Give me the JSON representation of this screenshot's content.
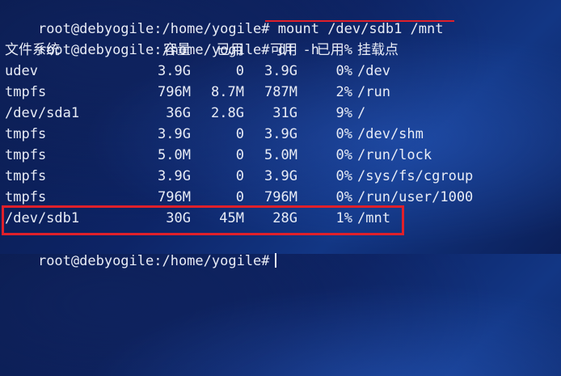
{
  "terminal": {
    "line1": {
      "prompt": "root@debyogile:/home/yogile#",
      "command": "mount /dev/sdb1 /mnt"
    },
    "line2": {
      "prompt": "root@debyogile:/home/yogile#",
      "command": "df -h"
    },
    "headers": {
      "filesystem": "文件系统",
      "size": "容量",
      "used": "已用",
      "avail": "可用",
      "use_pct": "已用%",
      "mounted_on": "挂载点"
    },
    "rows": [
      {
        "fs": "udev",
        "size": "3.9G",
        "used": "0",
        "avail": "3.9G",
        "pct": "0%",
        "mount": "/dev"
      },
      {
        "fs": "tmpfs",
        "size": "796M",
        "used": "8.7M",
        "avail": "787M",
        "pct": "2%",
        "mount": "/run"
      },
      {
        "fs": "/dev/sda1",
        "size": "36G",
        "used": "2.8G",
        "avail": "31G",
        "pct": "9%",
        "mount": "/"
      },
      {
        "fs": "tmpfs",
        "size": "3.9G",
        "used": "0",
        "avail": "3.9G",
        "pct": "0%",
        "mount": "/dev/shm"
      },
      {
        "fs": "tmpfs",
        "size": "5.0M",
        "used": "0",
        "avail": "5.0M",
        "pct": "0%",
        "mount": "/run/lock"
      },
      {
        "fs": "tmpfs",
        "size": "3.9G",
        "used": "0",
        "avail": "3.9G",
        "pct": "0%",
        "mount": "/sys/fs/cgroup"
      },
      {
        "fs": "tmpfs",
        "size": "796M",
        "used": "0",
        "avail": "796M",
        "pct": "0%",
        "mount": "/run/user/1000"
      },
      {
        "fs": "/dev/sdb1",
        "size": "30G",
        "used": "45M",
        "avail": "28G",
        "pct": "1%",
        "mount": "/mnt"
      }
    ],
    "last_line": {
      "prompt": "root@debyogile:/home/yogile#"
    },
    "highlight_color": "#e0202a"
  }
}
